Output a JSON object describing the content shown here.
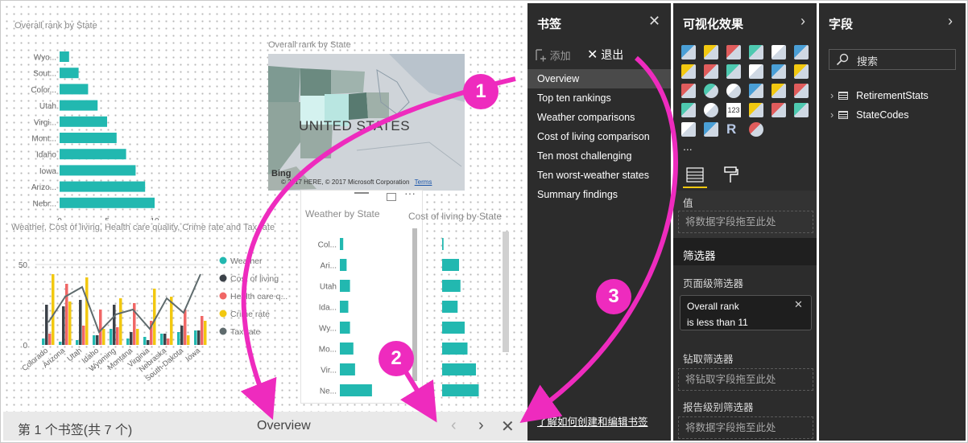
{
  "canvas": {
    "chart1_title": "Overall rank by State",
    "map_title": "Overall rank by State",
    "map_label": "UNITED STATES",
    "map_credit": "© 2017 HERE, © 2017 Microsoft Corporation",
    "map_terms": "Terms",
    "map_logo": "Bing",
    "combo_title": "Weather, Cost of living, Health care quality, Crime rate and Tax rate",
    "weather_title": "Weather by State",
    "cost_title": "Cost of living by State"
  },
  "chart_data": [
    {
      "type": "bar",
      "title": "Overall rank by State",
      "categories": [
        "Wyo...",
        "Sout...",
        "Color...",
        "Utah",
        "Virgi...",
        "Mont...",
        "Idaho",
        "Iowa",
        "Arizo...",
        "Nebr..."
      ],
      "values": [
        1,
        2,
        3,
        4,
        5,
        6,
        7,
        8,
        9,
        10
      ],
      "xlim": [
        0,
        10
      ],
      "xticks": [
        "0",
        "5",
        "10"
      ],
      "color": "#22b8b0"
    },
    {
      "type": "bar",
      "title": "Weather, Cost of living, Health care quality, Crime rate and Tax rate",
      "categories": [
        "Colorado",
        "Arizona",
        "Utah",
        "Idaho",
        "Wyoming",
        "Montana",
        "Virginia",
        "Nebraska",
        "South-Dakota",
        "Iowa"
      ],
      "series": [
        {
          "name": "Weather",
          "color": "#22b8b0",
          "values": [
            4,
            2,
            3,
            6,
            10,
            4,
            5,
            7,
            8,
            9
          ]
        },
        {
          "name": "Cost of living",
          "color": "#3c4249",
          "values": [
            25,
            24,
            28,
            6,
            25,
            8,
            3,
            7,
            12,
            9
          ]
        },
        {
          "name": "Health care q...",
          "color": "#f06766",
          "values": [
            7,
            38,
            12,
            22,
            11,
            26,
            15,
            4,
            22,
            18
          ]
        },
        {
          "name": "Crime rate",
          "color": "#f2c810",
          "values": [
            44,
            27,
            42,
            10,
            29,
            10,
            35,
            30,
            6,
            15
          ]
        },
        {
          "name": "Tax rate",
          "color": "#5f6b6d",
          "values": [
            14,
            30,
            36,
            8,
            19,
            22,
            10,
            29,
            20,
            44
          ]
        }
      ],
      "ylim": [
        0,
        50
      ],
      "yticks": [
        "0",
        "50"
      ],
      "legend": "right"
    },
    {
      "type": "bar",
      "title": "Weather by State",
      "categories": [
        "Col...",
        "Ari...",
        "Utah",
        "Ida...",
        "Wy...",
        "Mo...",
        "Vir...",
        "Ne..."
      ],
      "values": [
        2,
        4,
        6,
        5,
        6,
        8,
        9,
        19
      ],
      "xlim": [
        0,
        40
      ],
      "xticks": [
        "0",
        "20",
        "40"
      ],
      "color": "#22b8b0"
    },
    {
      "type": "bar",
      "title": "Cost of living by State",
      "categories": [
        "",
        "",
        "",
        "",
        "",
        "",
        "",
        ""
      ],
      "values": [
        1,
        12,
        13,
        11,
        16,
        18,
        24,
        26
      ],
      "xlim": [
        0,
        40
      ],
      "xticks": [
        "0",
        "20",
        "40"
      ],
      "color": "#22b8b0"
    }
  ],
  "bottom_bar": {
    "counter": "第 1 个书签(共 7 个)",
    "current": "Overview",
    "prev_glyph": "‹",
    "next_glyph": "›",
    "close_glyph": "✕"
  },
  "bookmarks_pane": {
    "title": "书签",
    "add_label": "添加",
    "exit_label": "退出",
    "items": [
      "Overview",
      "Top ten rankings",
      "Weather comparisons",
      "Cost of living comparison",
      "Ten most challenging",
      "Ten worst-weather states",
      "Summary findings"
    ],
    "learn_link": "了解如何创建和编辑书签"
  },
  "viz_pane": {
    "title": "可视化效果",
    "ellipsis": "...",
    "values_label": "值",
    "values_drop": "将数据字段拖至此处",
    "filters_label": "筛选器",
    "page_filters": "页面级筛选器",
    "filter_card_line1": "Overall rank",
    "filter_card_line2": "is less than 11",
    "drill_label": "钻取筛选器",
    "drill_drop": "将钻取字段拖至此处",
    "report_label": "报告级别筛选器",
    "report_drop": "将数据字段拖至此处",
    "r_glyph": "R",
    "num_glyph": "123"
  },
  "fields_pane": {
    "title": "字段",
    "search_placeholder": "搜索",
    "tables": [
      "RetirementStats",
      "StateCodes"
    ]
  },
  "annotations": [
    "1",
    "2",
    "3"
  ],
  "colors": {
    "accent_magenta": "#ee2bbe",
    "teal": "#22b8b0",
    "pane_bg": "#2c2c2c",
    "highlight_tab": "#f2c810"
  }
}
